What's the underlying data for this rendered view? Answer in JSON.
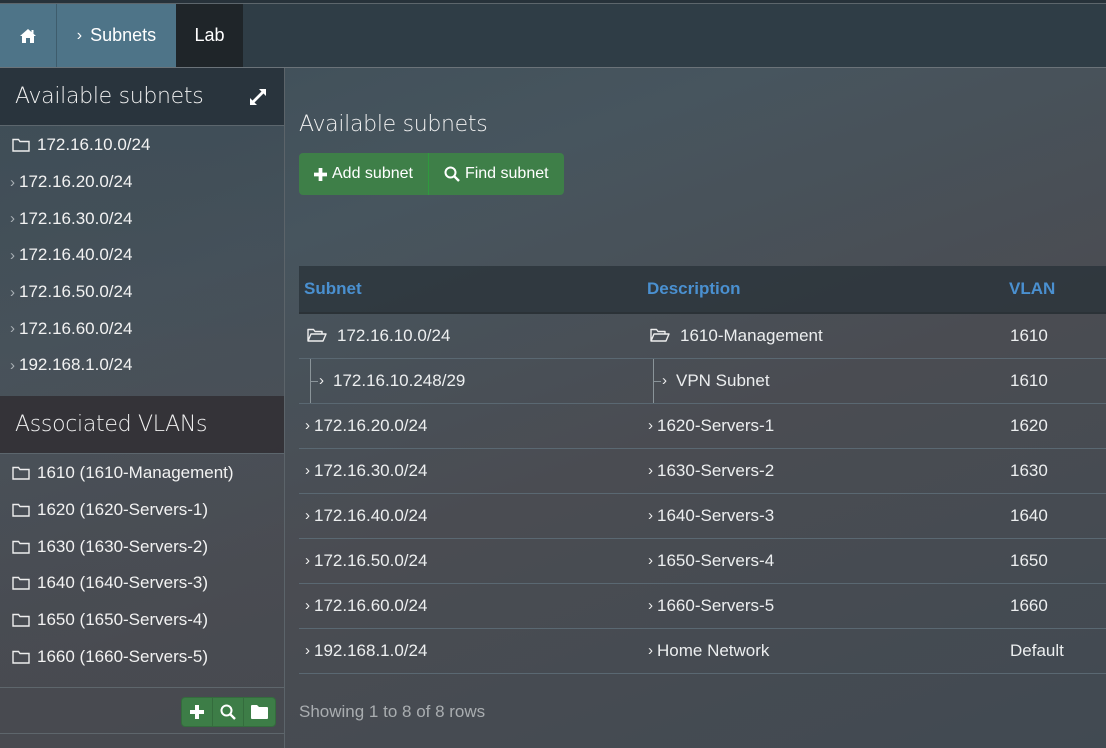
{
  "breadcrumb": {
    "home_icon": "home-icon",
    "items": [
      {
        "label": "Subnets",
        "icon": "chevron-right-icon"
      },
      {
        "label": "Lab"
      }
    ]
  },
  "sidebar": {
    "subnets_panel": {
      "title": "Available subnets",
      "expand_icon": "expand-icon",
      "items": [
        {
          "label": "172.16.10.0/24",
          "icon": "folder-icon"
        },
        {
          "label": "172.16.20.0/24",
          "icon": "chevron-right-icon"
        },
        {
          "label": "172.16.30.0/24",
          "icon": "chevron-right-icon"
        },
        {
          "label": "172.16.40.0/24",
          "icon": "chevron-right-icon"
        },
        {
          "label": "172.16.50.0/24",
          "icon": "chevron-right-icon"
        },
        {
          "label": "172.16.60.0/24",
          "icon": "chevron-right-icon"
        },
        {
          "label": "192.168.1.0/24",
          "icon": "chevron-right-icon"
        }
      ]
    },
    "vlans_panel": {
      "title": "Associated VLANs",
      "items": [
        {
          "label": "1610 (1610-Management)",
          "icon": "folder-icon"
        },
        {
          "label": "1620 (1620-Servers-1)",
          "icon": "folder-icon"
        },
        {
          "label": "1630 (1630-Servers-2)",
          "icon": "folder-icon"
        },
        {
          "label": "1640 (1640-Servers-3)",
          "icon": "folder-icon"
        },
        {
          "label": "1650 (1650-Servers-4)",
          "icon": "folder-icon"
        },
        {
          "label": "1660 (1660-Servers-5)",
          "icon": "folder-icon"
        }
      ]
    },
    "footer_buttons": [
      "plus-icon",
      "search-icon",
      "folder-solid-icon"
    ]
  },
  "main": {
    "title": "Available subnets",
    "buttons": {
      "add": "Add subnet",
      "find": "Find subnet"
    },
    "table": {
      "headers": [
        "Subnet",
        "Description",
        "VLAN"
      ],
      "rows": [
        {
          "subnet": "172.16.10.0/24",
          "description": "1610-Management",
          "vlan": "1610",
          "type": "parent-open"
        },
        {
          "subnet": "172.16.10.248/29",
          "description": "VPN Subnet",
          "vlan": "1610",
          "type": "child"
        },
        {
          "subnet": "172.16.20.0/24",
          "description": "1620-Servers-1",
          "vlan": "1620",
          "type": "collapsed"
        },
        {
          "subnet": "172.16.30.0/24",
          "description": "1630-Servers-2",
          "vlan": "1630",
          "type": "collapsed"
        },
        {
          "subnet": "172.16.40.0/24",
          "description": "1640-Servers-3",
          "vlan": "1640",
          "type": "collapsed"
        },
        {
          "subnet": "172.16.50.0/24",
          "description": "1650-Servers-4",
          "vlan": "1650",
          "type": "collapsed"
        },
        {
          "subnet": "172.16.60.0/24",
          "description": "1660-Servers-5",
          "vlan": "1660",
          "type": "collapsed"
        },
        {
          "subnet": "192.168.1.0/24",
          "description": "Home Network",
          "vlan": "Default",
          "type": "collapsed"
        }
      ]
    },
    "footer": "Showing 1 to 8 of 8 rows"
  },
  "colors": {
    "breadcrumb_active": "#4e7488",
    "breadcrumb_current": "#1f2529",
    "button_green": "#3e7f48",
    "table_header_text": "#4a90d0"
  }
}
